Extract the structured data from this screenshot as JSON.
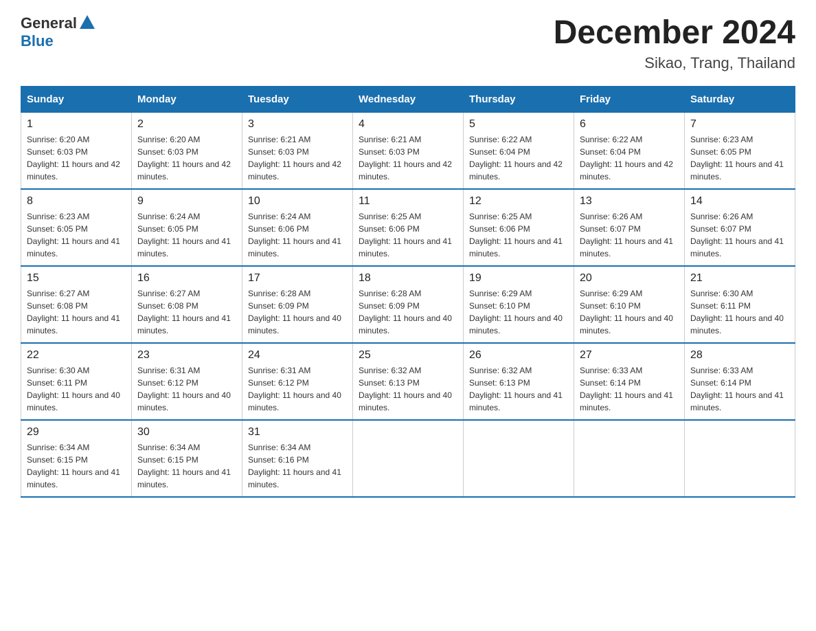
{
  "logo": {
    "text_general": "General",
    "text_blue": "Blue"
  },
  "title": "December 2024",
  "subtitle": "Sikao, Trang, Thailand",
  "days_of_week": [
    "Sunday",
    "Monday",
    "Tuesday",
    "Wednesday",
    "Thursday",
    "Friday",
    "Saturday"
  ],
  "weeks": [
    [
      {
        "day": "1",
        "sunrise": "6:20 AM",
        "sunset": "6:03 PM",
        "daylight": "11 hours and 42 minutes."
      },
      {
        "day": "2",
        "sunrise": "6:20 AM",
        "sunset": "6:03 PM",
        "daylight": "11 hours and 42 minutes."
      },
      {
        "day": "3",
        "sunrise": "6:21 AM",
        "sunset": "6:03 PM",
        "daylight": "11 hours and 42 minutes."
      },
      {
        "day": "4",
        "sunrise": "6:21 AM",
        "sunset": "6:03 PM",
        "daylight": "11 hours and 42 minutes."
      },
      {
        "day": "5",
        "sunrise": "6:22 AM",
        "sunset": "6:04 PM",
        "daylight": "11 hours and 42 minutes."
      },
      {
        "day": "6",
        "sunrise": "6:22 AM",
        "sunset": "6:04 PM",
        "daylight": "11 hours and 42 minutes."
      },
      {
        "day": "7",
        "sunrise": "6:23 AM",
        "sunset": "6:05 PM",
        "daylight": "11 hours and 41 minutes."
      }
    ],
    [
      {
        "day": "8",
        "sunrise": "6:23 AM",
        "sunset": "6:05 PM",
        "daylight": "11 hours and 41 minutes."
      },
      {
        "day": "9",
        "sunrise": "6:24 AM",
        "sunset": "6:05 PM",
        "daylight": "11 hours and 41 minutes."
      },
      {
        "day": "10",
        "sunrise": "6:24 AM",
        "sunset": "6:06 PM",
        "daylight": "11 hours and 41 minutes."
      },
      {
        "day": "11",
        "sunrise": "6:25 AM",
        "sunset": "6:06 PM",
        "daylight": "11 hours and 41 minutes."
      },
      {
        "day": "12",
        "sunrise": "6:25 AM",
        "sunset": "6:06 PM",
        "daylight": "11 hours and 41 minutes."
      },
      {
        "day": "13",
        "sunrise": "6:26 AM",
        "sunset": "6:07 PM",
        "daylight": "11 hours and 41 minutes."
      },
      {
        "day": "14",
        "sunrise": "6:26 AM",
        "sunset": "6:07 PM",
        "daylight": "11 hours and 41 minutes."
      }
    ],
    [
      {
        "day": "15",
        "sunrise": "6:27 AM",
        "sunset": "6:08 PM",
        "daylight": "11 hours and 41 minutes."
      },
      {
        "day": "16",
        "sunrise": "6:27 AM",
        "sunset": "6:08 PM",
        "daylight": "11 hours and 41 minutes."
      },
      {
        "day": "17",
        "sunrise": "6:28 AM",
        "sunset": "6:09 PM",
        "daylight": "11 hours and 40 minutes."
      },
      {
        "day": "18",
        "sunrise": "6:28 AM",
        "sunset": "6:09 PM",
        "daylight": "11 hours and 40 minutes."
      },
      {
        "day": "19",
        "sunrise": "6:29 AM",
        "sunset": "6:10 PM",
        "daylight": "11 hours and 40 minutes."
      },
      {
        "day": "20",
        "sunrise": "6:29 AM",
        "sunset": "6:10 PM",
        "daylight": "11 hours and 40 minutes."
      },
      {
        "day": "21",
        "sunrise": "6:30 AM",
        "sunset": "6:11 PM",
        "daylight": "11 hours and 40 minutes."
      }
    ],
    [
      {
        "day": "22",
        "sunrise": "6:30 AM",
        "sunset": "6:11 PM",
        "daylight": "11 hours and 40 minutes."
      },
      {
        "day": "23",
        "sunrise": "6:31 AM",
        "sunset": "6:12 PM",
        "daylight": "11 hours and 40 minutes."
      },
      {
        "day": "24",
        "sunrise": "6:31 AM",
        "sunset": "6:12 PM",
        "daylight": "11 hours and 40 minutes."
      },
      {
        "day": "25",
        "sunrise": "6:32 AM",
        "sunset": "6:13 PM",
        "daylight": "11 hours and 40 minutes."
      },
      {
        "day": "26",
        "sunrise": "6:32 AM",
        "sunset": "6:13 PM",
        "daylight": "11 hours and 41 minutes."
      },
      {
        "day": "27",
        "sunrise": "6:33 AM",
        "sunset": "6:14 PM",
        "daylight": "11 hours and 41 minutes."
      },
      {
        "day": "28",
        "sunrise": "6:33 AM",
        "sunset": "6:14 PM",
        "daylight": "11 hours and 41 minutes."
      }
    ],
    [
      {
        "day": "29",
        "sunrise": "6:34 AM",
        "sunset": "6:15 PM",
        "daylight": "11 hours and 41 minutes."
      },
      {
        "day": "30",
        "sunrise": "6:34 AM",
        "sunset": "6:15 PM",
        "daylight": "11 hours and 41 minutes."
      },
      {
        "day": "31",
        "sunrise": "6:34 AM",
        "sunset": "6:16 PM",
        "daylight": "11 hours and 41 minutes."
      },
      null,
      null,
      null,
      null
    ]
  ]
}
